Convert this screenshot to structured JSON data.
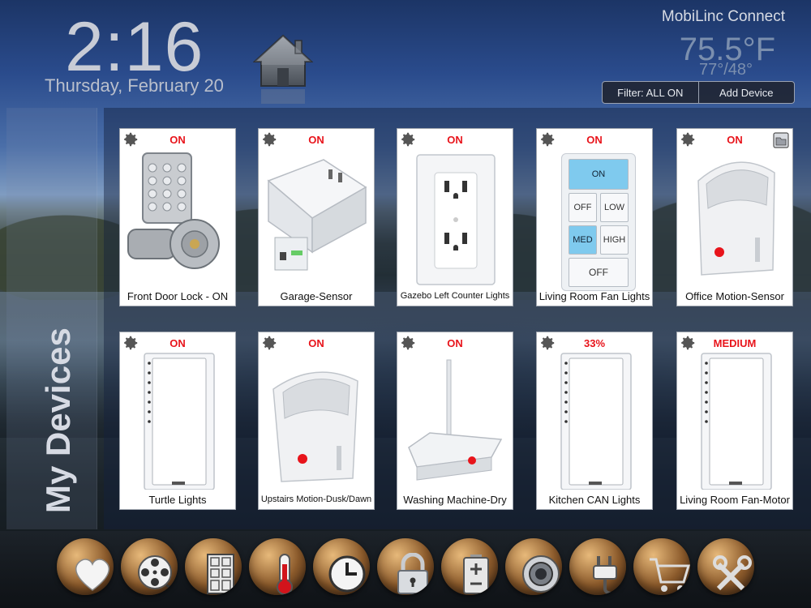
{
  "header": {
    "time": "2:16",
    "date": "Thursday, February 20",
    "brand": "MobiLinc Connect",
    "temperature": "75.5°F",
    "hi_lo": "77°/48°",
    "filter_label": "Filter: ALL ON",
    "add_device_label": "Add Device"
  },
  "sidebar": {
    "title": "My Devices"
  },
  "devices": [
    {
      "name": "Front Door Lock - ON",
      "state": "ON",
      "icon": "door-lock-keypad-icon"
    },
    {
      "name": "Garage-Sensor",
      "state": "ON",
      "icon": "plug-in-module-icon"
    },
    {
      "name": "Gazebo Left Counter Lights",
      "state": "ON",
      "icon": "outlet-icon"
    },
    {
      "name": "Living Room Fan Lights",
      "state": "ON",
      "icon": "keypad-icon"
    },
    {
      "name": "Office Motion-Sensor",
      "state": "ON",
      "icon": "motion-sensor-icon"
    },
    {
      "name": "Turtle Lights",
      "state": "ON",
      "icon": "dimmer-switch-icon"
    },
    {
      "name": "Upstairs Motion-Dusk/Dawn",
      "state": "ON",
      "icon": "motion-sensor-icon"
    },
    {
      "name": "Washing Machine-Dry",
      "state": "ON",
      "icon": "hub-antenna-icon"
    },
    {
      "name": "Kitchen CAN Lights",
      "state": "33%",
      "icon": "dimmer-switch-icon"
    },
    {
      "name": "Living Room Fan-Motor",
      "state": "MEDIUM",
      "icon": "dimmer-switch-icon"
    }
  ],
  "keypad": {
    "on": "ON",
    "off_small": "OFF",
    "low": "LOW",
    "med": "MED",
    "high": "HIGH",
    "off": "OFF"
  },
  "dock": [
    {
      "icon": "heart-icon"
    },
    {
      "icon": "film-reel-icon"
    },
    {
      "icon": "door-icon"
    },
    {
      "icon": "thermometer-icon"
    },
    {
      "icon": "clock-icon"
    },
    {
      "icon": "padlock-icon"
    },
    {
      "icon": "battery-icon"
    },
    {
      "icon": "camera-lens-icon"
    },
    {
      "icon": "power-plug-icon"
    },
    {
      "icon": "shopping-cart-icon"
    },
    {
      "icon": "tools-icon"
    }
  ],
  "colors": {
    "state_red": "#e8141b",
    "keypad_highlight": "#7fcaee",
    "dock_bronze": "#8b5a2b"
  }
}
